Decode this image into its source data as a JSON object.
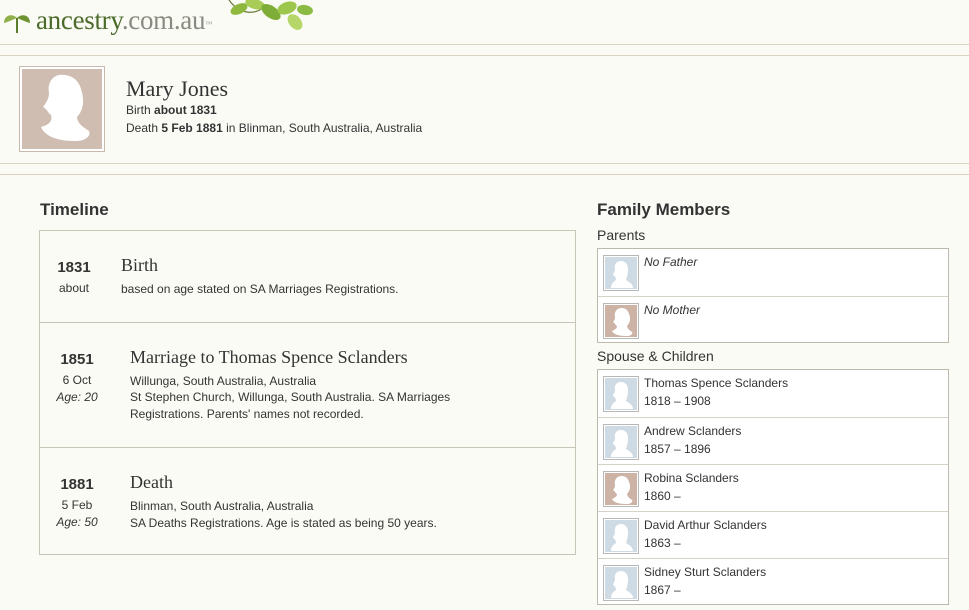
{
  "header": {
    "logo_main": "ancestry",
    "logo_domain": ".com.au",
    "logo_tm": "™"
  },
  "person": {
    "name": "Mary Jones",
    "birth_label": "Birth",
    "birth_value": "about 1831",
    "death_label": "Death",
    "death_value": "5 Feb 1881",
    "death_place_prefix": "in",
    "death_place": "Blinman, South Australia, Australia"
  },
  "timeline": {
    "title": "Timeline",
    "events": [
      {
        "year": "1831",
        "date": "about",
        "age": "",
        "title": "Birth",
        "lines": [
          "based on age stated on SA Marriages Registrations."
        ]
      },
      {
        "year": "1851",
        "date": "6 Oct",
        "age": "Age: 20",
        "title": "Marriage to Thomas Spence Sclanders",
        "lines": [
          "Willunga, South Australia, Australia",
          "St Stephen Church, Willunga, South Australia. SA Marriages",
          "Registrations. Parents' names not recorded."
        ]
      },
      {
        "year": "1881",
        "date": "5 Feb",
        "age": "Age: 50",
        "title": "Death",
        "lines": [
          "Blinman, South Australia, Australia",
          "SA Deaths Registrations. Age is stated as being 50 years."
        ]
      }
    ]
  },
  "family": {
    "title": "Family Members",
    "parents_label": "Parents",
    "parents": [
      {
        "name": "No Father",
        "dates": "",
        "gender": "male"
      },
      {
        "name": "No Mother",
        "dates": "",
        "gender": "female"
      }
    ],
    "spouse_label": "Spouse & Children",
    "spouse_children": [
      {
        "name": "Thomas Spence Sclanders",
        "dates": "1818 – 1908",
        "gender": "male"
      },
      {
        "name": "Andrew Sclanders",
        "dates": "1857 – 1896",
        "gender": "male"
      },
      {
        "name": "Robina Sclanders",
        "dates": "1860 –",
        "gender": "female"
      },
      {
        "name": "David Arthur Sclanders",
        "dates": "1863 –",
        "gender": "male"
      },
      {
        "name": "Sidney Sturt Sclanders",
        "dates": "1867 –",
        "gender": "male"
      }
    ]
  },
  "colors": {
    "background": "#fbfbf6",
    "logo_green": "#4c6b2a",
    "rule": "#d8d3c2",
    "male_thumb": "#cfdbe4",
    "female_thumb": "#cdb3a6"
  }
}
